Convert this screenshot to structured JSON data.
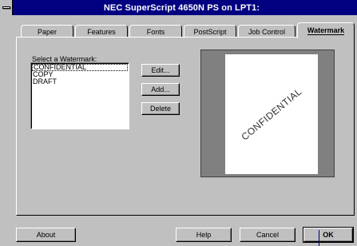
{
  "window": {
    "title": "NEC SuperScript 4650N PS on LPT1:"
  },
  "tabs": [
    {
      "label": "Paper"
    },
    {
      "label": "Features"
    },
    {
      "label": "Fonts"
    },
    {
      "label": "PostScript"
    },
    {
      "label": "Job Control"
    },
    {
      "label": "Watermark",
      "active": true
    }
  ],
  "watermark": {
    "list_label": "Select a Watermark:",
    "items": [
      "CONFIDENTIAL",
      "COPY",
      "DRAFT"
    ],
    "selected": "CONFIDENTIAL",
    "edit_label": "Edit...",
    "add_label": "Add...",
    "delete_label": "Delete",
    "preview_text": "CONFIDENTIAL"
  },
  "footer": {
    "about_label": "About",
    "help_label": "Help",
    "cancel_label": "Cancel",
    "ok_label": "OK"
  }
}
